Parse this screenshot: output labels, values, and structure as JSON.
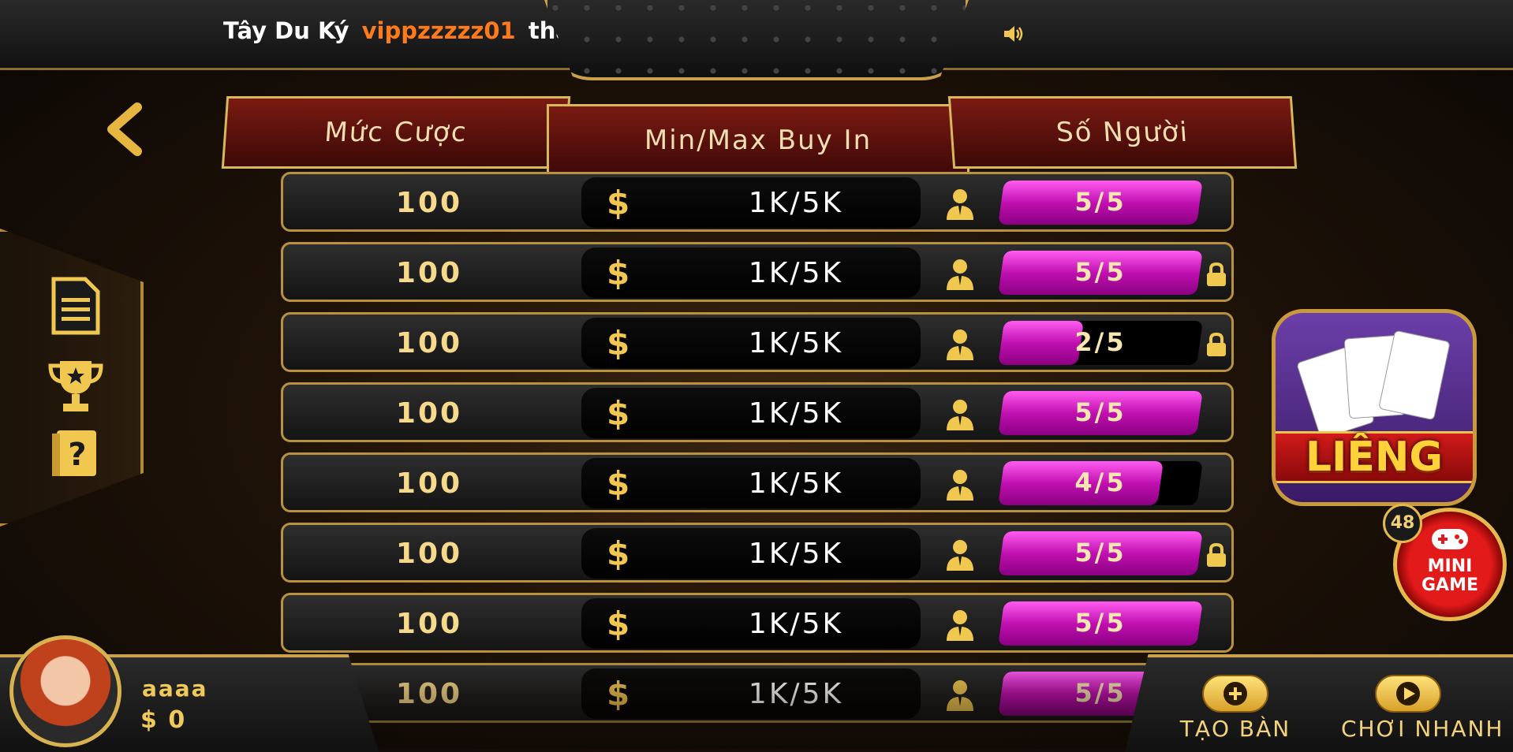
{
  "marquee": {
    "game": "Tây Du Ký",
    "user": "vippzzzzz01",
    "action": "thắng"
  },
  "icons": {
    "speaker": "speaker-icon",
    "back": "chevron-left-icon",
    "list": "document-icon",
    "trophy": "trophy-icon",
    "help": "help-book-icon",
    "dollar": "dollar-icon",
    "person": "person-icon",
    "lock": "lock-icon"
  },
  "headers": {
    "bet": "Mức Cược",
    "buyin": "Min/Max Buy In",
    "players": "Số Người"
  },
  "rows": [
    {
      "bet": "100",
      "dollar": "$",
      "buyin": "1K/5K",
      "players": "5/5",
      "fill": 1.0,
      "locked": false
    },
    {
      "bet": "100",
      "dollar": "$",
      "buyin": "1K/5K",
      "players": "5/5",
      "fill": 1.0,
      "locked": true
    },
    {
      "bet": "100",
      "dollar": "$",
      "buyin": "1K/5K",
      "players": "2/5",
      "fill": 0.4,
      "locked": true
    },
    {
      "bet": "100",
      "dollar": "$",
      "buyin": "1K/5K",
      "players": "5/5",
      "fill": 1.0,
      "locked": false
    },
    {
      "bet": "100",
      "dollar": "$",
      "buyin": "1K/5K",
      "players": "4/5",
      "fill": 0.8,
      "locked": false
    },
    {
      "bet": "100",
      "dollar": "$",
      "buyin": "1K/5K",
      "players": "5/5",
      "fill": 1.0,
      "locked": true
    },
    {
      "bet": "100",
      "dollar": "$",
      "buyin": "1K/5K",
      "players": "5/5",
      "fill": 1.0,
      "locked": false
    },
    {
      "bet": "100",
      "dollar": "$",
      "buyin": "1K/5K",
      "players": "5/5",
      "fill": 1.0,
      "locked": false
    }
  ],
  "game_logo": {
    "title": "LIÊNG"
  },
  "mini_game": {
    "badge": "48",
    "label_line1": "MINI",
    "label_line2": "GAME"
  },
  "user": {
    "name": "aaaa",
    "money": "$ 0"
  },
  "buttons": {
    "create_table": "TẠO BÀN",
    "quick_play": "CHƠI NHANH"
  },
  "colors": {
    "gold": "#d8b85a",
    "magenta": "#c010b0",
    "orange_user": "#ff7a1a",
    "header_red": "#7a1a12"
  }
}
